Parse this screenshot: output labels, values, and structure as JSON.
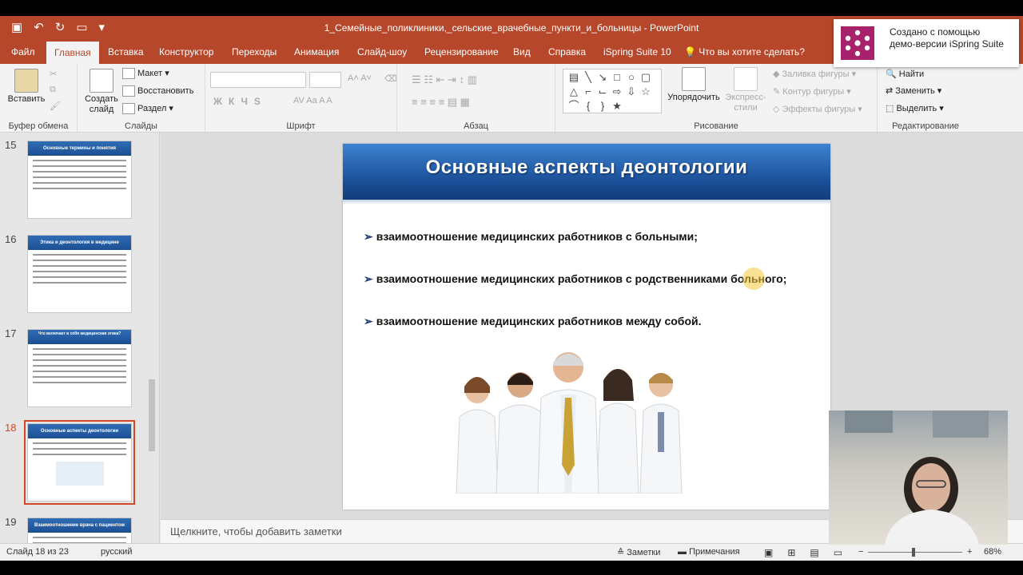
{
  "app": {
    "window_title": "1_Семейные_поликлиники,_сельские_врачебные_пункти_и_больницы  -  PowerPoint",
    "tabs": [
      {
        "label": "Файл",
        "active": false
      },
      {
        "label": "Главная",
        "active": true
      },
      {
        "label": "Вставка",
        "active": false
      },
      {
        "label": "Конструктор",
        "active": false
      },
      {
        "label": "Переходы",
        "active": false
      },
      {
        "label": "Анимация",
        "active": false
      },
      {
        "label": "Слайд-шоу",
        "active": false
      },
      {
        "label": "Рецензирование",
        "active": false
      },
      {
        "label": "Вид",
        "active": false
      },
      {
        "label": "Справка",
        "active": false
      },
      {
        "label": "iSpring Suite 10",
        "active": false
      }
    ],
    "tell_me": "Что вы хотите сделать?",
    "accent_color": "#b7472a"
  },
  "ribbon": {
    "clipboard": {
      "group_label": "Буфер обмена",
      "paste": "Вставить"
    },
    "slides": {
      "group_label": "Слайды",
      "new_slide_line1": "Создать",
      "new_slide_line2": "слайд",
      "layout": "Макет",
      "reset": "Восстановить",
      "section": "Раздел"
    },
    "font": {
      "group_label": "Шрифт",
      "bold": "Ж",
      "italic": "К",
      "underline": "Ч",
      "strike": "S"
    },
    "paragraph": {
      "group_label": "Абзац"
    },
    "drawing": {
      "group_label": "Рисование",
      "arrange": "Упорядочить",
      "quick_styles_line1": "Экспресс-",
      "quick_styles_line2": "стили",
      "shape_fill": "Заливка фигуры",
      "shape_outline": "Контур фигуры",
      "shape_effects": "Эффекты фигуры"
    },
    "editing": {
      "group_label": "Редактирование",
      "find": "Найти",
      "replace": "Заменить",
      "select": "Выделить"
    }
  },
  "thumbnails": [
    {
      "number": "15",
      "title": "Основные термины и понятия",
      "selected": false
    },
    {
      "number": "16",
      "title": "Этика и деонтология в медицине",
      "selected": false
    },
    {
      "number": "17",
      "title": "Что включает в себя медицинская этика?",
      "selected": false
    },
    {
      "number": "18",
      "title": "Основные аспекты деонтологии",
      "selected": true
    },
    {
      "number": "19",
      "title": "Взаимоотношение врача с пациентом",
      "selected": false
    }
  ],
  "slide": {
    "title": "Основные аспекты деонтологии",
    "bullets": [
      "взаимоотношение медицинских работников с больными;",
      "взаимоотношение медицинских работников с родственниками больного;",
      "взаимоотношение медицинских работников между собой."
    ]
  },
  "notes_placeholder": "Щелкните, чтобы добавить заметки",
  "status": {
    "slide_counter": "Слайд 18 из 23",
    "language": "русский",
    "notes": "Заметки",
    "comments": "Примечания",
    "zoom": "68%"
  },
  "toast": {
    "text": "Создано с помощью\nдемо-версии iSpring Suite"
  }
}
